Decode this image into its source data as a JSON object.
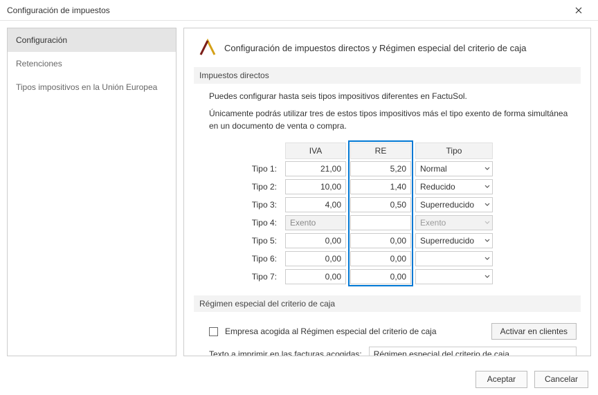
{
  "window": {
    "title": "Configuración de impuestos"
  },
  "sidebar": {
    "items": [
      {
        "label": "Configuración"
      },
      {
        "label": "Retenciones"
      },
      {
        "label": "Tipos impositivos en la Unión Europea"
      }
    ]
  },
  "main": {
    "heading": "Configuración de impuestos directos y Régimen especial del criterio de caja",
    "section1_title": "Impuestos directos",
    "info1": "Puedes configurar hasta seis tipos impositivos diferentes en FactuSol.",
    "info2": "Únicamente podrás utilizar tres de estos tipos impositivos más el tipo exento de forma simultánea en un documento de venta o compra.",
    "table": {
      "headers": {
        "iva": "IVA",
        "re": "RE",
        "tipo": "Tipo"
      },
      "rows": [
        {
          "label": "Tipo 1:",
          "iva": "21,00",
          "re": "5,20",
          "tipo": "Normal",
          "readonly": false
        },
        {
          "label": "Tipo 2:",
          "iva": "10,00",
          "re": "1,40",
          "tipo": "Reducido",
          "readonly": false
        },
        {
          "label": "Tipo 3:",
          "iva": "4,00",
          "re": "0,50",
          "tipo": "Superreducido",
          "readonly": false
        },
        {
          "label": "Tipo 4:",
          "iva": "Exento",
          "re": "",
          "tipo": "Exento",
          "readonly": true
        },
        {
          "label": "Tipo 5:",
          "iva": "0,00",
          "re": "0,00",
          "tipo": "Superreducido",
          "readonly": false
        },
        {
          "label": "Tipo 6:",
          "iva": "0,00",
          "re": "0,00",
          "tipo": "",
          "readonly": false
        },
        {
          "label": "Tipo 7:",
          "iva": "0,00",
          "re": "0,00",
          "tipo": "",
          "readonly": false
        }
      ]
    },
    "section2_title": "Régimen especial del criterio de caja",
    "checkbox_label": "Empresa acogida al Régimen especial del criterio de caja",
    "activar_button": "Activar en clientes",
    "texto_label": "Texto a imprimir en las facturas acogidas:",
    "texto_value": "Régimen especial del criterio de caja"
  },
  "footer": {
    "accept": "Aceptar",
    "cancel": "Cancelar"
  }
}
